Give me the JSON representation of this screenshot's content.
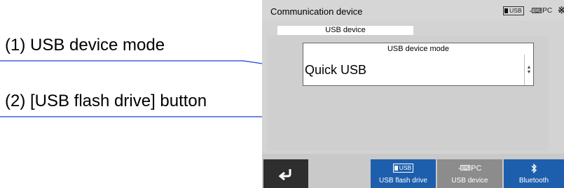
{
  "callouts": [
    {
      "label": "(1) USB device mode"
    },
    {
      "label": "(2) [USB flash drive] button"
    }
  ],
  "screen": {
    "title": "Communication device",
    "status_icons": {
      "usb_label": "USB",
      "pc_label": "PC",
      "bluetooth_icon": "bluetooth-icon"
    },
    "section_title": "USB device",
    "mode_field": {
      "label": "USB device mode",
      "value": "Quick USB"
    },
    "bottom_bar": {
      "back_icon": "return-arrow-icon",
      "buttons": [
        {
          "icon_text": "USB",
          "label": "USB flash drive",
          "state": "active"
        },
        {
          "icon_text": "PC",
          "label": "USB device",
          "state": "inactive"
        },
        {
          "icon_text": "",
          "label": "Bluetooth",
          "state": "active"
        }
      ]
    }
  },
  "colors": {
    "accent_blue": "#1d5fad",
    "inactive_gray": "#8c8c8c",
    "back_button": "#2e2e2e",
    "callout_line": "#1a3fd6"
  }
}
